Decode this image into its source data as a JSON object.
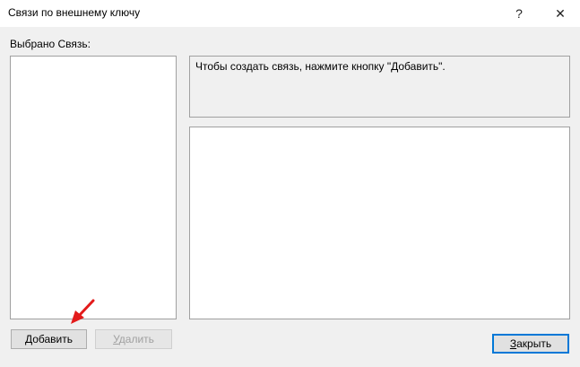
{
  "window": {
    "title": "Связи по внешнему ключу",
    "help_glyph": "?",
    "close_glyph": "✕"
  },
  "selection": {
    "label": "Выбрано Связь:"
  },
  "info": {
    "message": "Чтобы создать связь, нажмите кнопку \"Добавить\"."
  },
  "buttons": {
    "add_first": "Д",
    "add_rest": "обавить",
    "delete_first": "У",
    "delete_rest": "далить",
    "close_first": "З",
    "close_rest": "акрыть"
  },
  "colors": {
    "accent": "#0078d7",
    "arrow": "#e31b1b"
  }
}
